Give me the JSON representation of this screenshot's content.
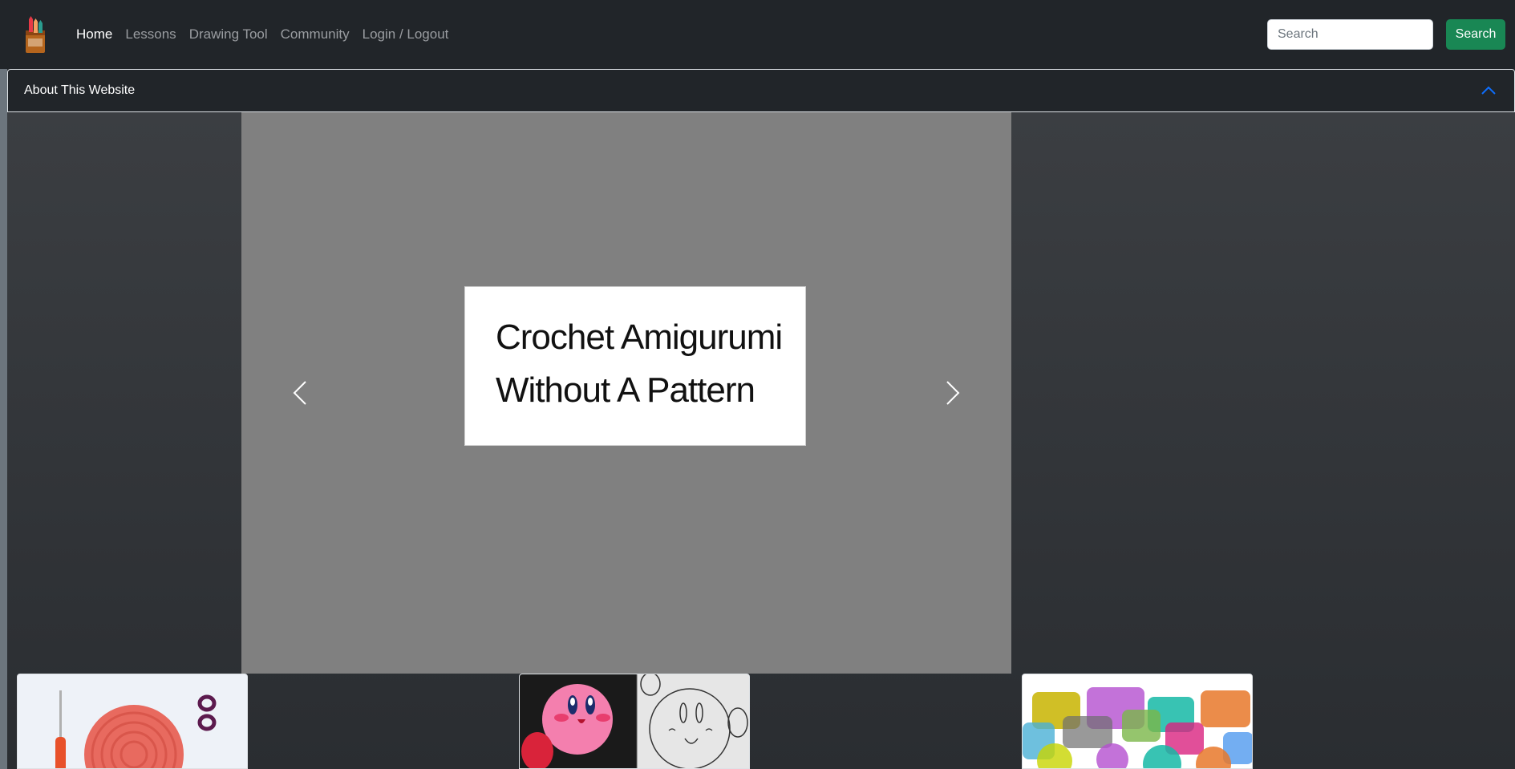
{
  "navbar": {
    "logo_icon": "crayon-box-logo-icon",
    "links": [
      {
        "label": "Home",
        "active": true
      },
      {
        "label": "Lessons",
        "active": false
      },
      {
        "label": "Drawing Tool",
        "active": false
      },
      {
        "label": "Community",
        "active": false
      },
      {
        "label": "Login / Logout",
        "active": false
      }
    ],
    "search": {
      "placeholder": "Search",
      "button_label": "Search"
    }
  },
  "accordion": {
    "title": "About This Website",
    "expanded": true,
    "icon": "chevron-up-icon"
  },
  "carousel": {
    "slide_lines": [
      "Crochet Amigurumi",
      "Without A Pattern"
    ],
    "prev_icon": "chevron-left-icon",
    "next_icon": "chevron-right-icon"
  },
  "cards": [
    {
      "image": "crochet-circle-image"
    },
    {
      "image": "kirby-drawing-comparison-image"
    },
    {
      "image": "speech-bubbles-image"
    }
  ],
  "colors": {
    "navbar_bg": "#212529",
    "search_button": "#198754",
    "chevron_accent": "#0d6efd",
    "carousel_bg": "#808080"
  }
}
